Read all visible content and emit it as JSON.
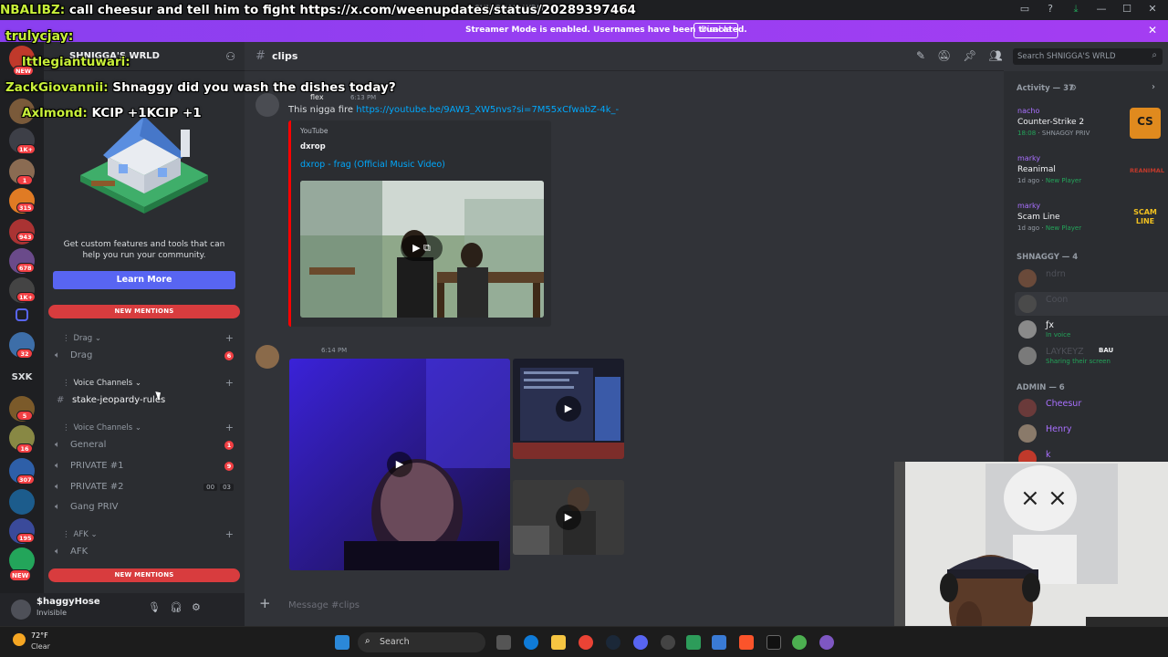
{
  "titlebar": {
    "title": "SHNIGGA'S WRLD",
    "icons": [
      "inbox-icon",
      "help-icon",
      "download-icon",
      "minimize-icon",
      "maximize-icon",
      "close-icon"
    ]
  },
  "banner": {
    "text": "Streamer Mode is enabled. Usernames have been truncated.",
    "button": "Disable"
  },
  "rail": {
    "badges": [
      "NEW",
      "1K+",
      "1",
      "315",
      "943",
      "678",
      "1K+",
      "32",
      "5",
      "16",
      "307",
      "195",
      "NEW"
    ],
    "server_text": "SXK"
  },
  "sidebar": {
    "server_name": "SHNIGGA'S WRLD",
    "promo_text": "Get custom features and tools that can help you run your community.",
    "promo_button": "Learn More",
    "new_mentions_top": "NEW MENTIONS",
    "new_mentions_bottom": "NEW MENTIONS",
    "categories": [
      {
        "name": "Drag",
        "channels": [
          {
            "name": "Drag",
            "badge": "6"
          }
        ]
      },
      {
        "name": "Voice Channels",
        "channels": [
          {
            "name": "stake-jeopardy-rules"
          }
        ]
      },
      {
        "name": "Voice Channels",
        "channels": [
          {
            "name": "General",
            "badge": "1"
          },
          {
            "name": "PRIVATE #1",
            "badge": "9"
          },
          {
            "name": "PRIVATE #2",
            "counts": [
              "00",
              "03"
            ]
          },
          {
            "name": "Gang PRIV"
          }
        ]
      },
      {
        "name": "AFK",
        "channels": [
          {
            "name": "AFK"
          }
        ]
      }
    ]
  },
  "user_panel": {
    "name": "$haggyHose",
    "status": "Invisible"
  },
  "chat": {
    "channel": "clips",
    "search_placeholder": "Search SHNIGGA'S WRLD",
    "input_placeholder": "Message #clips",
    "messages": [
      {
        "author": "flex",
        "time": "6:13 PM",
        "text": "This nigga fire",
        "link": "https://youtube.be/9AW3_XW5nvs?si=7M55xCfwabZ-4k_-",
        "embed": {
          "provider": "YouTube",
          "author": "dxrop",
          "title": "dxrop - frag (Official Music Video)"
        }
      },
      {
        "time": "6:14 PM"
      }
    ]
  },
  "members": {
    "activity_header": "Activity — 37",
    "activities": [
      {
        "user": "nacho",
        "game": "Counter-Strike 2",
        "time": "18:08",
        "where": "SHNAGGY PRIV",
        "art": "CS"
      },
      {
        "user": "marky",
        "game": "Reanimal",
        "time": "1d ago",
        "where": "New Player",
        "art": "REANIMAL"
      },
      {
        "user": "marky",
        "game": "Scam Line",
        "time": "1d ago",
        "where": "New Player",
        "art": "SCAM LINE"
      }
    ],
    "group1": "SHNAGGY — 4",
    "group1_members": [
      {
        "name": "ndrn",
        "sub": ""
      },
      {
        "name": "Coon",
        "sub": ""
      },
      {
        "name": "ƒx",
        "sub": "In voice"
      },
      {
        "name": "LAYKEYZ",
        "tag": "BAU",
        "sub": "Sharing their screen"
      }
    ],
    "group2": "ADMIN — 6",
    "group2_members": [
      {
        "name": "Cheesur"
      },
      {
        "name": "Henry"
      },
      {
        "name": "k"
      }
    ]
  },
  "overlay_chat": [
    {
      "name": "NBALIBZ:",
      "text": " call cheesur and tell him to fight https://x.com/weenupdates/status/20289397464"
    },
    {
      "name": "trulycjay:",
      "text": ""
    },
    {
      "name": "lttlegiantuwari:",
      "text": ""
    },
    {
      "name": "ZackGiovannii:",
      "text": " Shnaggy did you wash the dishes today?"
    },
    {
      "name": "Axlmond:",
      "text": " KCIP +1KCIP +1"
    }
  ],
  "taskbar": {
    "temp": "72°F",
    "condition": "Clear",
    "search": "Search"
  },
  "colors": {
    "brand": "#5865f2",
    "mention_red": "#d83c3e",
    "link": "#00a8fc",
    "banner": "#a43df2"
  }
}
